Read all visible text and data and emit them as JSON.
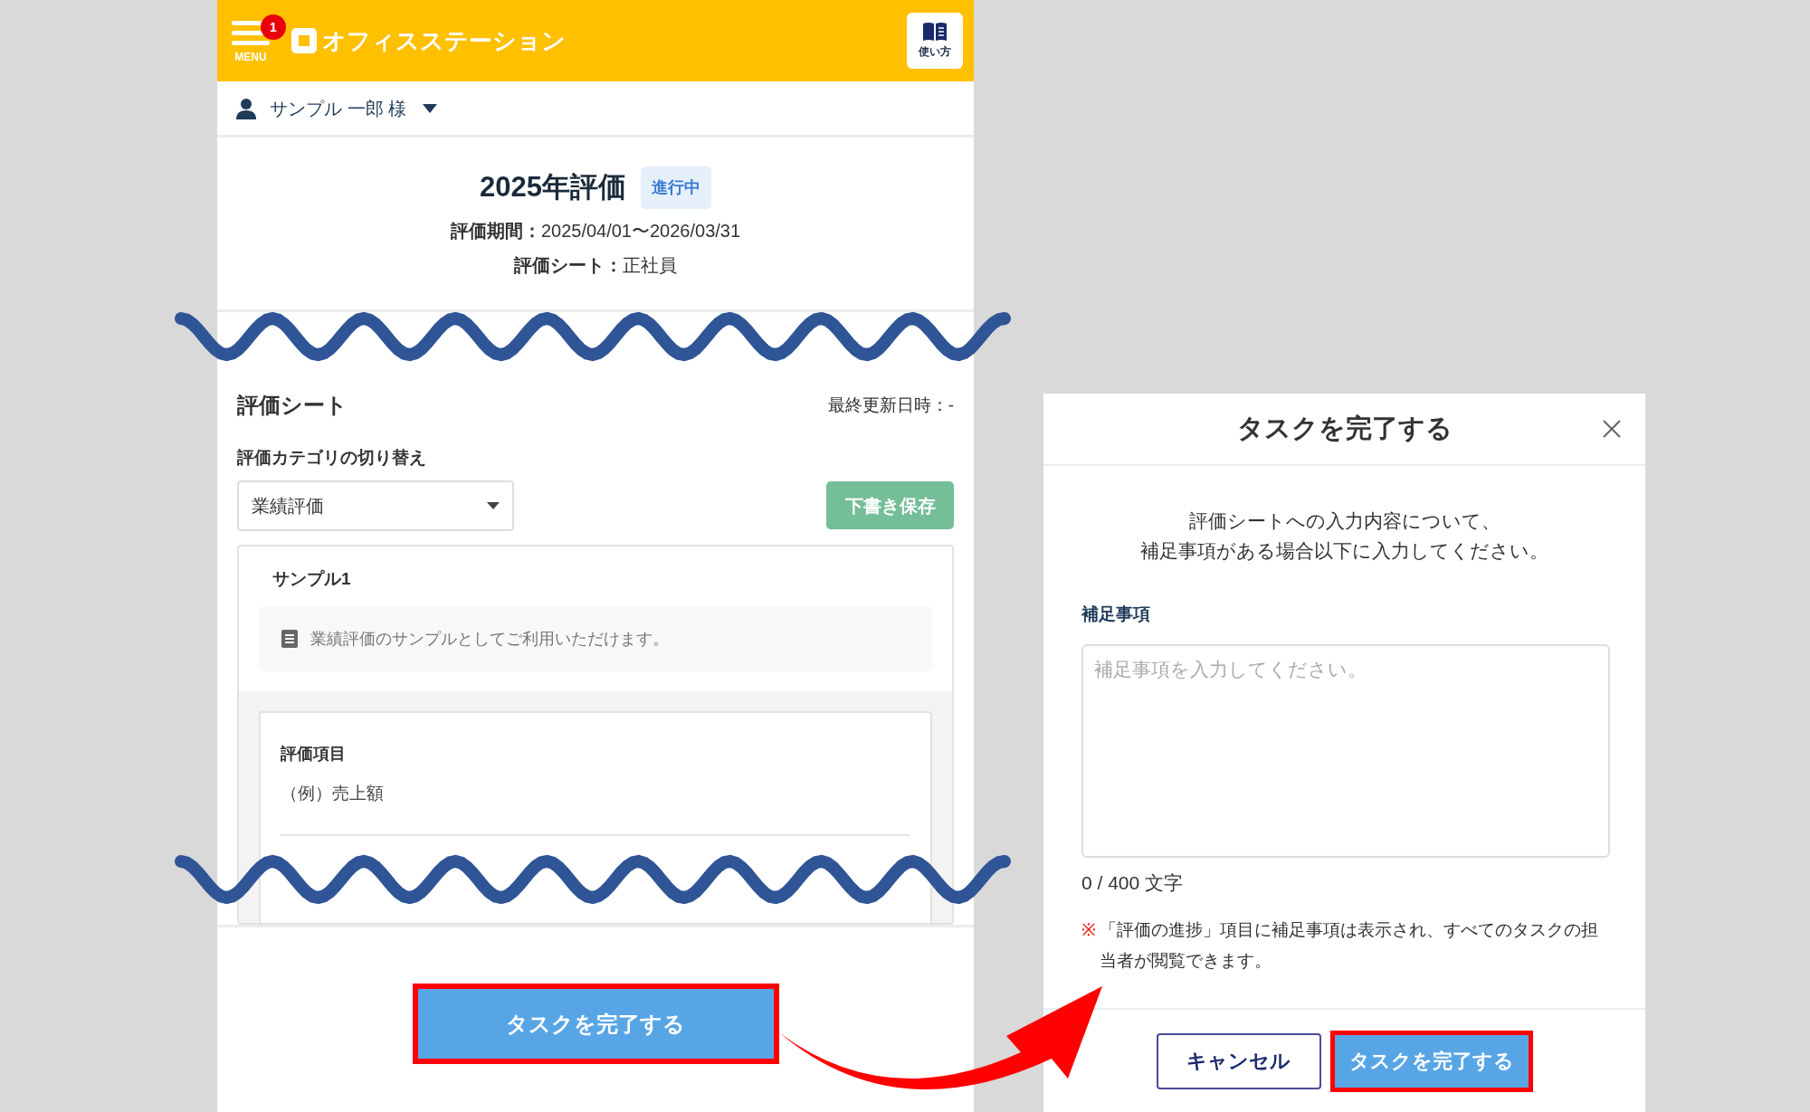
{
  "header": {
    "menu_label": "MENU",
    "notification_count": "1",
    "app_name": "オフィスステーション",
    "help_label": "使い方"
  },
  "user": {
    "name": "サンプル 一郎 様"
  },
  "evaluation": {
    "title": "2025年評価",
    "status": "進行中",
    "details": [
      {
        "label": "評価期間：",
        "value": "2025/04/01〜2026/03/31"
      },
      {
        "label": "評価シート：",
        "value": "正社員"
      }
    ]
  },
  "sheet": {
    "title": "評価シート",
    "last_updated": "最終更新日時：-",
    "category_label": "評価カテゴリの切り替え",
    "category_value": "業績評価",
    "draft_button": "下書き保存",
    "card": {
      "title": "サンプル1",
      "description": "業績評価のサンプルとしてご利用いただけます。",
      "item_label": "評価項目",
      "item_value": "（例）売上額"
    }
  },
  "complete_button": "タスクを完了する",
  "modal": {
    "title": "タスクを完了する",
    "intro": [
      "評価シートへの入力内容について、",
      "補足事項がある場合以下に入力してください。"
    ],
    "field_label": "補足事項",
    "placeholder": "補足事項を入力してください。",
    "counter": "0 / 400 文字",
    "note_mark": "※",
    "note": "「評価の進捗」項目に補足事項は表示され、すべてのタスクの担当者が閲覧できます。",
    "cancel_button": "キャンセル",
    "submit_button": "タスクを完了する"
  }
}
